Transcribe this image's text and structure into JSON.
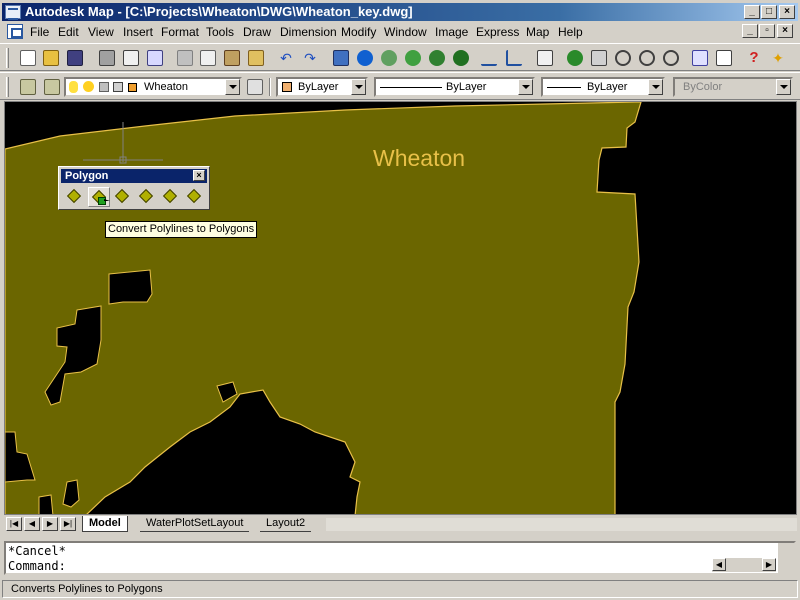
{
  "window": {
    "title": "Autodesk Map - [C:\\Projects\\Wheaton\\DWG\\Wheaton_key.dwg]",
    "minimize": "_",
    "maximize": "□",
    "close": "×",
    "mdi_restore": "▫",
    "mdi_close": "×"
  },
  "menu": [
    "File",
    "Edit",
    "View",
    "Insert",
    "Format",
    "Tools",
    "Draw",
    "Dimension",
    "Modify",
    "Window",
    "Image",
    "Express",
    "Map",
    "Help"
  ],
  "layers_toolbar": {
    "layer_name": "Wheaton",
    "color_value": "ByLayer",
    "linetype_value": "ByLayer",
    "lineweight_value": "ByLayer",
    "plotstyle_value": "ByColor",
    "layer_swatch_color": "#f0a030",
    "color_swatch": "#f0b070"
  },
  "drawing": {
    "map_label": "Wheaton",
    "fill_color": "#6b6600",
    "edge_color": "#e8c048",
    "background": "#000000"
  },
  "polygon_toolbar": {
    "title": "Polygon",
    "close_glyph": "×",
    "buttons": [
      "create-polygon",
      "convert-polylines-to-polygons",
      "edit-polygon",
      "add-vertex",
      "polygon-properties",
      "check-polygon"
    ]
  },
  "tooltip": "Convert Polylines to Polygons",
  "layout_tabs": {
    "nav": [
      "|◀",
      "◀",
      "▶",
      "▶|"
    ],
    "tabs": [
      {
        "label": "Model",
        "active": true
      },
      {
        "label": "WaterPlotSetLayout",
        "active": false
      },
      {
        "label": "Layout2",
        "active": false
      }
    ]
  },
  "command": {
    "history": "*Cancel*",
    "prompt": "Command:"
  },
  "status_text": "Converts Polylines to Polygons"
}
